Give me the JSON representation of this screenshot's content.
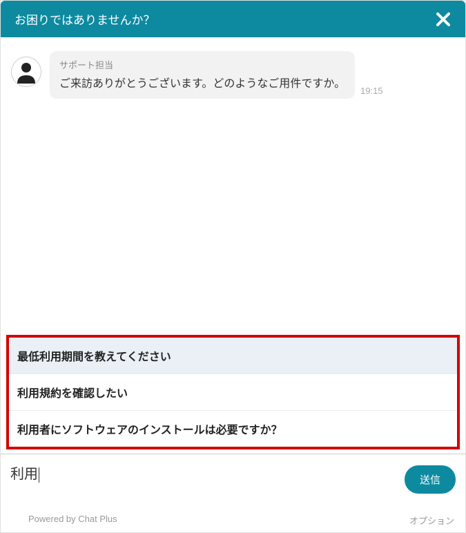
{
  "header": {
    "title": "お困りではありませんか？"
  },
  "message": {
    "sender": "サポート担当",
    "text": "ご来訪ありがとうございます。どのようなご用件ですか。",
    "timestamp": "19:15"
  },
  "suggestions": [
    {
      "label": "最低利用期間を教えてください",
      "selected": true
    },
    {
      "label": "利用規約を確認したい",
      "selected": false
    },
    {
      "label": "利用者にソフトウェアのインストールは必要ですか？",
      "selected": false
    }
  ],
  "input": {
    "value": "利用",
    "send_label": "送信"
  },
  "footer": {
    "powered": "Powered by Chat Plus",
    "options": "オプション"
  },
  "colors": {
    "accent": "#0d8aa0",
    "highlight_border": "#d40000"
  }
}
